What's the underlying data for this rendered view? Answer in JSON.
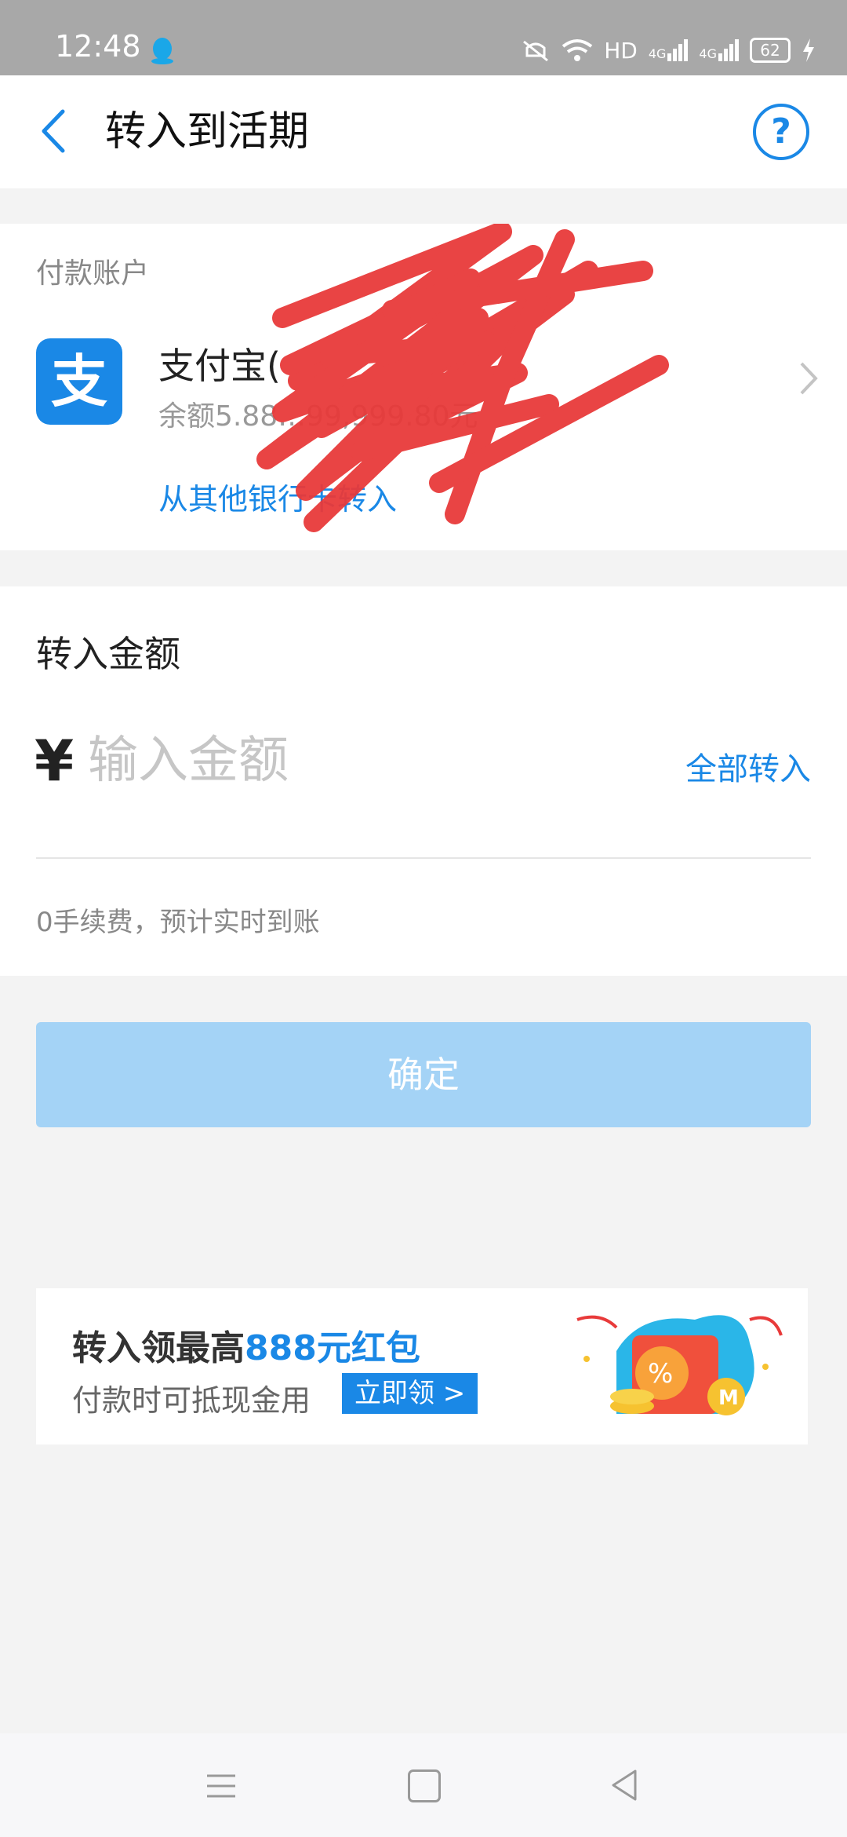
{
  "status_bar": {
    "time": "12:48",
    "network": "HD",
    "signal1": "4G",
    "signal2": "4G",
    "battery": "62"
  },
  "header": {
    "title": "转入到活期",
    "help_symbol": "?"
  },
  "payment_account": {
    "section_label": "付款账户",
    "logo_char": "支",
    "name": "支付宝(",
    "balance_text": "余额5.88…99,999.80元",
    "other_bank_link": "从其他银行卡转入"
  },
  "amount": {
    "label": "转入金额",
    "currency_symbol": "¥",
    "placeholder": "输入金额",
    "transfer_all": "全部转入",
    "fee_note": "0手续费，预计实时到账"
  },
  "confirm_button": "确定",
  "promo": {
    "line1_prefix": "转入领最高",
    "line1_highlight": "888元红包",
    "line2": "付款时可抵现金用",
    "button": "立即领 >"
  },
  "colors": {
    "accent": "#1a88e6",
    "confirm_disabled": "#a4d3f6",
    "scribble": "#e83a3a"
  }
}
